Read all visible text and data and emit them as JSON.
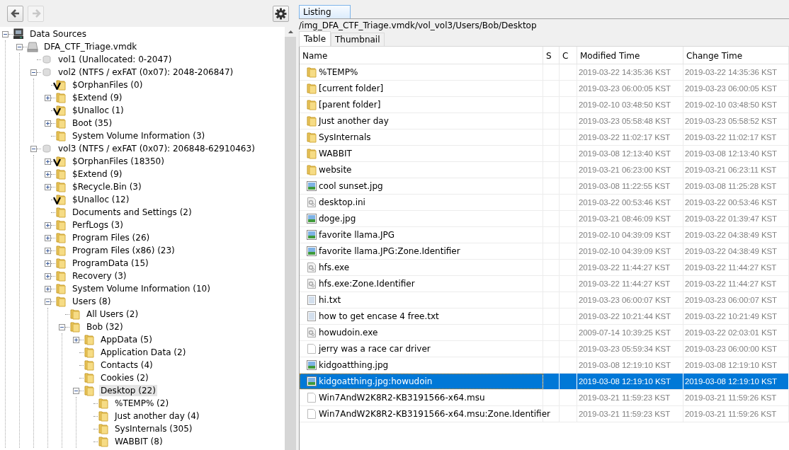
{
  "toolbar": {
    "buttons": [
      {
        "kind": "back",
        "disabled": false
      },
      {
        "kind": "forward",
        "disabled": true
      },
      {
        "kind": "settings",
        "disabled": false
      }
    ]
  },
  "tree": {
    "nodes": [
      {
        "label": "Data Sources",
        "kind": "computer",
        "expanded": true,
        "children": [
          {
            "label": "DFA_CTF_Triage.vmdk",
            "kind": "disk",
            "expanded": true,
            "children": [
              {
                "label": "vol1 (Unallocated: 0-2047)",
                "kind": "volume"
              },
              {
                "label": "vol2 (NTFS / exFAT (0x07): 2048-206847)",
                "kind": "volume",
                "expanded": true,
                "children": [
                  {
                    "label": "$OrphanFiles (0)",
                    "kind": "folder",
                    "flagged": true
                  },
                  {
                    "label": "$Extend (9)",
                    "kind": "folder",
                    "expanded": false
                  },
                  {
                    "label": "$Unalloc (1)",
                    "kind": "folder",
                    "flagged": true
                  },
                  {
                    "label": "Boot (35)",
                    "kind": "folder",
                    "expanded": false
                  },
                  {
                    "label": "System Volume Information (3)",
                    "kind": "folder"
                  }
                ]
              },
              {
                "label": "vol3 (NTFS / exFAT (0x07): 206848-62910463)",
                "kind": "volume",
                "expanded": true,
                "children": [
                  {
                    "label": "$OrphanFiles (18350)",
                    "kind": "folder",
                    "flagged": true,
                    "expanded": false
                  },
                  {
                    "label": "$Extend (9)",
                    "kind": "folder",
                    "expanded": false
                  },
                  {
                    "label": "$Recycle.Bin (3)",
                    "kind": "folder",
                    "expanded": false
                  },
                  {
                    "label": "$Unalloc (12)",
                    "kind": "folder",
                    "flagged": true
                  },
                  {
                    "label": "Documents and Settings (2)",
                    "kind": "folder"
                  },
                  {
                    "label": "PerfLogs (3)",
                    "kind": "folder",
                    "expanded": false
                  },
                  {
                    "label": "Program Files (26)",
                    "kind": "folder",
                    "expanded": false
                  },
                  {
                    "label": "Program Files (x86) (23)",
                    "kind": "folder",
                    "expanded": false
                  },
                  {
                    "label": "ProgramData (15)",
                    "kind": "folder",
                    "expanded": false
                  },
                  {
                    "label": "Recovery (3)",
                    "kind": "folder",
                    "expanded": false
                  },
                  {
                    "label": "System Volume Information (10)",
                    "kind": "folder",
                    "expanded": false
                  },
                  {
                    "label": "Users (8)",
                    "kind": "folder",
                    "expanded": true,
                    "children": [
                      {
                        "label": "All Users (2)",
                        "kind": "folder"
                      },
                      {
                        "label": "Bob (32)",
                        "kind": "folder",
                        "expanded": true,
                        "children": [
                          {
                            "label": "AppData (5)",
                            "kind": "folder",
                            "expanded": false
                          },
                          {
                            "label": "Application Data (2)",
                            "kind": "folder"
                          },
                          {
                            "label": "Contacts (4)",
                            "kind": "folder"
                          },
                          {
                            "label": "Cookies (2)",
                            "kind": "folder"
                          },
                          {
                            "label": "Desktop (22)",
                            "kind": "folder",
                            "expanded": true,
                            "selected": true,
                            "children": [
                              {
                                "label": "%TEMP% (2)",
                                "kind": "folder"
                              },
                              {
                                "label": "Just another day (4)",
                                "kind": "folder"
                              },
                              {
                                "label": "SysInternals (305)",
                                "kind": "folder"
                              },
                              {
                                "label": "WABBIT (8)",
                                "kind": "folder"
                              }
                            ]
                          }
                        ]
                      }
                    ]
                  }
                ]
              }
            ]
          }
        ]
      }
    ]
  },
  "listing": {
    "tabs": [
      {
        "label": "Listing",
        "selected": true
      }
    ],
    "path": "/img_DFA_CTF_Triage.vmdk/vol_vol3/Users/Bob/Desktop",
    "view_tabs": [
      {
        "label": "Table",
        "selected": true
      },
      {
        "label": "Thumbnail",
        "selected": false
      }
    ],
    "table": {
      "columns": [
        "Name",
        "S",
        "C",
        "Modified Time",
        "Change Time"
      ],
      "rows": [
        {
          "name": "%TEMP%",
          "kind": "folder",
          "selected": false,
          "modified": "2019-03-22 14:35:36 KST",
          "changed": "2019-03-22 14:35:36 KST"
        },
        {
          "name": "[current folder]",
          "kind": "folder",
          "selected": false,
          "modified": "2019-03-23 06:00:05 KST",
          "changed": "2019-03-23 06:00:05 KST"
        },
        {
          "name": "[parent folder]",
          "kind": "folder",
          "selected": false,
          "modified": "2019-02-10 03:48:50 KST",
          "changed": "2019-02-10 03:48:50 KST"
        },
        {
          "name": "Just another day",
          "kind": "folder",
          "selected": false,
          "modified": "2019-03-23 05:58:48 KST",
          "changed": "2019-03-23 05:58:52 KST"
        },
        {
          "name": "SysInternals",
          "kind": "folder",
          "selected": false,
          "modified": "2019-03-22 11:02:17 KST",
          "changed": "2019-03-22 11:02:17 KST"
        },
        {
          "name": "WABBIT",
          "kind": "folder",
          "selected": false,
          "modified": "2019-03-08 12:13:40 KST",
          "changed": "2019-03-08 12:13:40 KST"
        },
        {
          "name": "website",
          "kind": "folder",
          "selected": false,
          "modified": "2019-03-21 06:23:00 KST",
          "changed": "2019-03-21 06:23:11 KST"
        },
        {
          "name": "cool sunset.jpg",
          "kind": "image",
          "selected": false,
          "modified": "2019-03-08 11:22:55 KST",
          "changed": "2019-03-08 11:25:28 KST"
        },
        {
          "name": "desktop.ini",
          "kind": "program",
          "selected": false,
          "modified": "2019-03-22 00:53:46 KST",
          "changed": "2019-03-22 00:53:46 KST"
        },
        {
          "name": "doge.jpg",
          "kind": "image",
          "selected": false,
          "modified": "2019-03-21 08:46:09 KST",
          "changed": "2019-03-22 01:39:47 KST"
        },
        {
          "name": "favorite llama.JPG",
          "kind": "image",
          "selected": false,
          "modified": "2019-02-10 04:39:09 KST",
          "changed": "2019-03-22 04:38:49 KST"
        },
        {
          "name": "favorite llama.JPG:Zone.Identifier",
          "kind": "image",
          "selected": false,
          "modified": "2019-02-10 04:39:09 KST",
          "changed": "2019-03-22 04:38:49 KST"
        },
        {
          "name": "hfs.exe",
          "kind": "program",
          "selected": false,
          "modified": "2019-03-22 11:44:27 KST",
          "changed": "2019-03-22 11:44:27 KST"
        },
        {
          "name": "hfs.exe:Zone.Identifier",
          "kind": "program",
          "selected": false,
          "modified": "2019-03-22 11:44:27 KST",
          "changed": "2019-03-22 11:44:27 KST"
        },
        {
          "name": "hi.txt",
          "kind": "text",
          "selected": false,
          "modified": "2019-03-23 06:00:07 KST",
          "changed": "2019-03-23 06:00:07 KST"
        },
        {
          "name": "how to get encase 4 free.txt",
          "kind": "text",
          "selected": false,
          "modified": "2019-03-22 10:21:44 KST",
          "changed": "2019-03-22 10:21:49 KST"
        },
        {
          "name": "howudoin.exe",
          "kind": "program",
          "selected": false,
          "modified": "2009-07-14 10:39:25 KST",
          "changed": "2019-03-22 02:03:01 KST"
        },
        {
          "name": "jerry was a race car driver",
          "kind": "file",
          "selected": false,
          "modified": "2019-03-23 05:59:34 KST",
          "changed": "2019-03-23 06:00:00 KST"
        },
        {
          "name": "kidgoatthing.jpg",
          "kind": "image",
          "selected": false,
          "modified": "2019-03-08 12:19:10 KST",
          "changed": "2019-03-08 12:19:10 KST"
        },
        {
          "name": "kidgoatthing.jpg:howudoin",
          "kind": "image",
          "selected": true,
          "modified": "2019-03-08 12:19:10 KST",
          "changed": "2019-03-08 12:19:10 KST"
        },
        {
          "name": "Win7AndW2K8R2-KB3191566-x64.msu",
          "kind": "file",
          "selected": false,
          "modified": "2019-03-21 11:59:23 KST",
          "changed": "2019-03-21 11:59:26 KST"
        },
        {
          "name": "Win7AndW2K8R2-KB3191566-x64.msu:Zone.Identifier",
          "kind": "file",
          "selected": false,
          "modified": "2019-03-21 11:59:23 KST",
          "changed": "2019-03-21 11:59:26 KST"
        }
      ]
    }
  }
}
